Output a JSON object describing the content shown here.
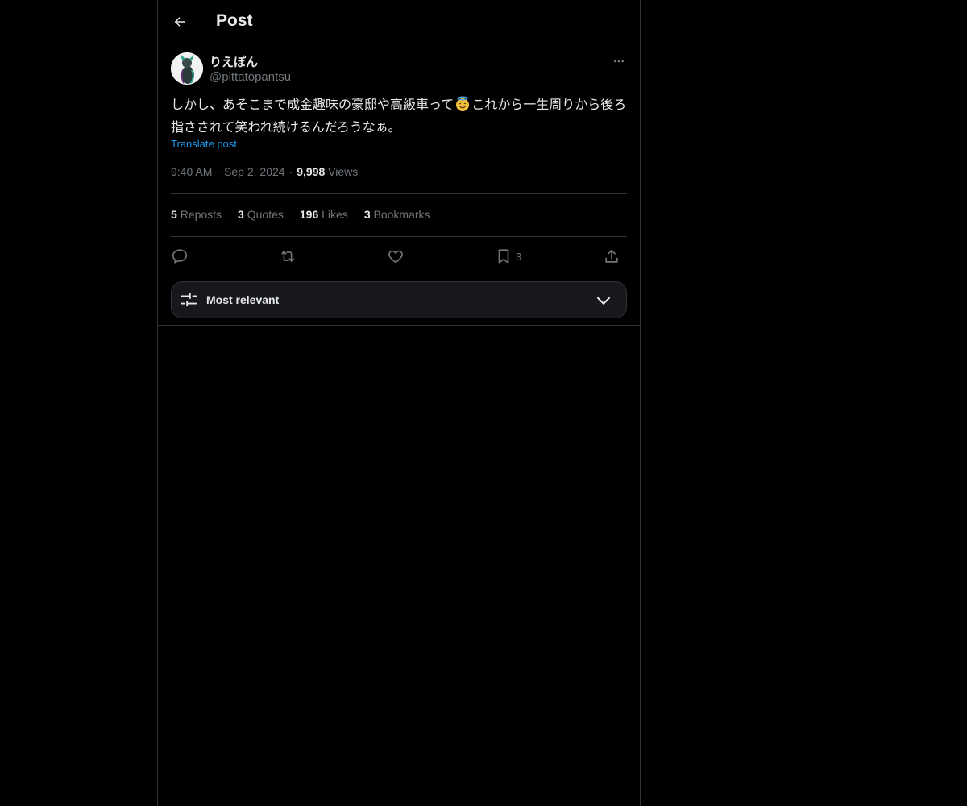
{
  "header": {
    "title": "Post",
    "back_icon": "arrow-left-icon"
  },
  "author": {
    "display_name": "りえぽん",
    "handle": "@pittatopantsu",
    "avatar_icon": "user-avatar"
  },
  "post": {
    "text_before_emoji": "しかし、あそこまで成金趣味の豪邸や高級車って",
    "emoji": "smiling-face-with-halo",
    "text_after_emoji": "これから一生周りから後ろ指さされて笑われ続けるんだろうなぁ。",
    "translate_label": "Translate post"
  },
  "meta": {
    "time": "9:40 AM",
    "date": "Sep 2, 2024",
    "views_count": "9,998",
    "views_label": "Views"
  },
  "stats": {
    "reposts_count": "5",
    "reposts_label": "Reposts",
    "quotes_count": "3",
    "quotes_label": "Quotes",
    "likes_count": "196",
    "likes_label": "Likes",
    "bookmarks_count": "3",
    "bookmarks_label": "Bookmarks"
  },
  "actions": {
    "bookmark_count": "3"
  },
  "sort": {
    "label": "Most relevant"
  },
  "colors": {
    "background": "#000000",
    "text": "#e7e9ea",
    "muted": "#71767b",
    "link": "#1d9bf0",
    "border": "#2f3336"
  }
}
